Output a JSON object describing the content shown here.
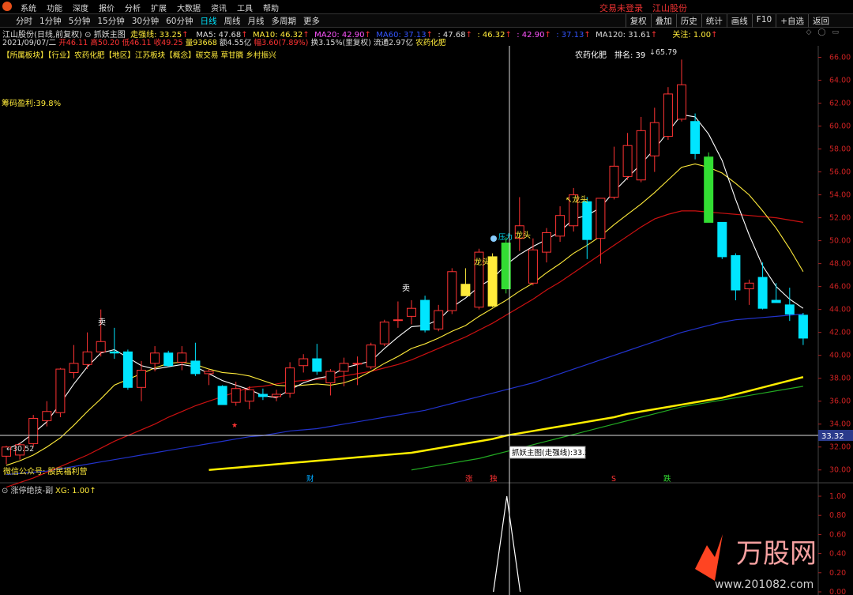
{
  "menubar": {
    "items": [
      "系统",
      "功能",
      "深度",
      "报价",
      "分析",
      "扩展",
      "大数据",
      "资讯",
      "工具",
      "帮助"
    ],
    "login_status": "交易未登录",
    "stock_title": "江山股份"
  },
  "periodbar": {
    "tabs": [
      "分时",
      "1分钟",
      "5分钟",
      "15分钟",
      "30分钟",
      "60分钟",
      "日线",
      "周线",
      "月线",
      "多周期",
      "更多"
    ],
    "active_tab": "日线",
    "tools": [
      "复权",
      "叠加",
      "历史",
      "统计",
      "画线",
      "F10",
      "+自选",
      "返回"
    ]
  },
  "info": {
    "stock_label": "江山股份(日线,前复权)",
    "indicator_name": "抓妖主图",
    "strong_line": "走强线: 33.25",
    "ma5": "MA5: 47.68",
    "ma10": "MA10: 46.32",
    "ma20": "MA20: 42.90",
    "ma60": "MA60: 37.13",
    "v1": ": 47.68",
    "v2": ": 46.32",
    "v3": ": 42.90",
    "v4": ": 37.13",
    "ma120": "MA120: 31.61",
    "focus": "关注: 1.00",
    "date": "2021/09/07/二",
    "open": "开46.11",
    "high": "高50.20",
    "low": "低46.11",
    "close": "收49.25",
    "volume": "量93668",
    "amount": "额4.55亿",
    "change": "幅3.60(7.89%)",
    "turnover": "换3.15%(里复权)",
    "float_shares": "流通2.97亿",
    "industry_tag": "农药化肥",
    "sector_line": "【所属板块】【行业】农药化肥【地区】江苏板块【概念】碳交易 草甘膦 乡村振兴"
  },
  "chart_labels": {
    "chip_profit": "筹码盈利:39.8%",
    "ranking_industry": "农药化肥",
    "ranking": "排名: 39",
    "peak_price": "65.79",
    "low_price": "30.52",
    "crosshair_label": "抓妖主图(走强线):33.25",
    "crosshair_price": "33.32",
    "wechat": "微信公众号: 股民福利营",
    "sell_1": "卖",
    "sell_2": "卖",
    "dragon_1": "龙头",
    "dragon_2": "龙头",
    "dragon_3": "龙头",
    "pressure": "压力",
    "event_cai": "财",
    "event_zhang": "涨",
    "event_du": "独",
    "event_s": "S",
    "event_die": "跌",
    "sub_indicator": "涨停绝技-副",
    "sub_value": "XG: 1.00",
    "watermark_name": "万股网",
    "watermark_url": "www.201082.com"
  },
  "y_axis_main": [
    "66.00",
    "64.00",
    "62.00",
    "60.00",
    "58.00",
    "56.00",
    "54.00",
    "52.00",
    "50.00",
    "48.00",
    "46.00",
    "44.00",
    "42.00",
    "40.00",
    "38.00",
    "36.00",
    "34.00",
    "32.00",
    "30.00"
  ],
  "y_axis_sub": [
    "1.00",
    "0.80",
    "0.60",
    "0.40",
    "0.20",
    "0.00"
  ],
  "chart_data": {
    "type": "candlestick",
    "y_range": [
      29.5,
      67
    ],
    "candles": [
      {
        "o": 31.2,
        "h": 32.1,
        "l": 30.5,
        "c": 32.0
      },
      {
        "o": 31.3,
        "h": 32.4,
        "l": 30.9,
        "c": 32.2
      },
      {
        "o": 32.3,
        "h": 34.8,
        "l": 32.0,
        "c": 34.5
      },
      {
        "o": 34.3,
        "h": 36.0,
        "l": 33.8,
        "c": 35.1
      },
      {
        "o": 35.0,
        "h": 38.9,
        "l": 34.6,
        "c": 38.8
      },
      {
        "o": 38.5,
        "h": 40.9,
        "l": 38.0,
        "c": 39.3
      },
      {
        "o": 39.2,
        "h": 42.0,
        "l": 38.8,
        "c": 40.3
      },
      {
        "o": 40.3,
        "h": 44.0,
        "l": 39.9,
        "c": 41.2
      },
      {
        "o": 40.3,
        "h": 42.4,
        "l": 39.7,
        "c": 40.2
      },
      {
        "o": 40.3,
        "h": 40.5,
        "l": 37.0,
        "c": 37.2
      },
      {
        "o": 37.2,
        "h": 39.5,
        "l": 36.0,
        "c": 38.7
      },
      {
        "o": 39.3,
        "h": 40.8,
        "l": 38.6,
        "c": 40.2
      },
      {
        "o": 40.2,
        "h": 40.4,
        "l": 39.0,
        "c": 39.1
      },
      {
        "o": 39.4,
        "h": 40.8,
        "l": 38.7,
        "c": 40.2
      },
      {
        "o": 39.5,
        "h": 41.1,
        "l": 38.2,
        "c": 38.4
      },
      {
        "o": 38.4,
        "h": 38.8,
        "l": 37.4,
        "c": 38.6
      },
      {
        "o": 37.3,
        "h": 37.4,
        "l": 35.8,
        "c": 35.7
      },
      {
        "o": 35.9,
        "h": 37.7,
        "l": 35.6,
        "c": 37.1
      },
      {
        "o": 36.0,
        "h": 37.3,
        "l": 35.3,
        "c": 37.0
      },
      {
        "o": 36.6,
        "h": 37.1,
        "l": 36.1,
        "c": 36.4
      },
      {
        "o": 36.4,
        "h": 37.0,
        "l": 36.0,
        "c": 36.6
      },
      {
        "o": 36.7,
        "h": 39.4,
        "l": 36.3,
        "c": 38.9
      },
      {
        "o": 39.1,
        "h": 40.1,
        "l": 38.5,
        "c": 39.7
      },
      {
        "o": 39.7,
        "h": 41.0,
        "l": 38.3,
        "c": 38.6
      },
      {
        "o": 37.6,
        "h": 38.8,
        "l": 36.5,
        "c": 38.6
      },
      {
        "o": 38.6,
        "h": 39.8,
        "l": 37.3,
        "c": 39.3
      },
      {
        "o": 39.3,
        "h": 39.9,
        "l": 37.4,
        "c": 39.3
      },
      {
        "o": 39.0,
        "h": 41.1,
        "l": 38.8,
        "c": 40.9
      },
      {
        "o": 41.0,
        "h": 43.1,
        "l": 40.8,
        "c": 42.9
      },
      {
        "o": 43.1,
        "h": 44.7,
        "l": 42.4,
        "c": 43.1
      },
      {
        "o": 43.4,
        "h": 44.8,
        "l": 42.7,
        "c": 44.1
      },
      {
        "o": 44.8,
        "h": 45.2,
        "l": 42.0,
        "c": 42.2
      },
      {
        "o": 42.3,
        "h": 44.4,
        "l": 42.1,
        "c": 43.9
      },
      {
        "o": 43.9,
        "h": 47.6,
        "l": 43.6,
        "c": 47.3
      },
      {
        "o": 46.2,
        "h": 47.6,
        "l": 45.3,
        "c": 45.2
      },
      {
        "o": 44.2,
        "h": 49.3,
        "l": 44.0,
        "c": 49.0
      },
      {
        "o": 44.3,
        "h": 48.9,
        "l": 44.2,
        "c": 48.6
      },
      {
        "o": 45.8,
        "h": 50.3,
        "l": 45.4,
        "c": 49.8
      },
      {
        "o": 50.2,
        "h": 53.8,
        "l": 49.1,
        "c": 51.3
      },
      {
        "o": 46.3,
        "h": 50.2,
        "l": 46.1,
        "c": 49.2
      },
      {
        "o": 49.0,
        "h": 51.1,
        "l": 48.1,
        "c": 50.7
      },
      {
        "o": 50.4,
        "h": 53.0,
        "l": 49.9,
        "c": 52.2
      },
      {
        "o": 51.3,
        "h": 54.6,
        "l": 50.8,
        "c": 54.0
      },
      {
        "o": 53.4,
        "h": 53.8,
        "l": 48.4,
        "c": 50.1
      },
      {
        "o": 50.2,
        "h": 53.4,
        "l": 48.0,
        "c": 53.7
      },
      {
        "o": 53.8,
        "h": 58.2,
        "l": 53.6,
        "c": 56.5
      },
      {
        "o": 55.6,
        "h": 59.4,
        "l": 55.3,
        "c": 58.3
      },
      {
        "o": 55.3,
        "h": 60.8,
        "l": 55.1,
        "c": 59.6
      },
      {
        "o": 57.4,
        "h": 61.6,
        "l": 56.0,
        "c": 60.3
      },
      {
        "o": 59.1,
        "h": 63.4,
        "l": 58.8,
        "c": 62.8
      },
      {
        "o": 60.6,
        "h": 65.8,
        "l": 60.4,
        "c": 63.6
      },
      {
        "o": 60.4,
        "h": 61.1,
        "l": 57.1,
        "c": 57.6
      },
      {
        "o": 57.3,
        "h": 57.7,
        "l": 51.6,
        "c": 51.6
      },
      {
        "o": 51.6,
        "h": 51.6,
        "l": 48.4,
        "c": 48.6
      },
      {
        "o": 48.7,
        "h": 48.9,
        "l": 44.8,
        "c": 45.7
      },
      {
        "o": 45.8,
        "h": 46.6,
        "l": 44.4,
        "c": 46.3
      },
      {
        "o": 46.8,
        "h": 48.1,
        "l": 44.0,
        "c": 44.1
      },
      {
        "o": 44.8,
        "h": 46.3,
        "l": 44.6,
        "c": 44.6
      },
      {
        "o": 44.4,
        "h": 45.9,
        "l": 43.0,
        "c": 43.6
      },
      {
        "o": 43.5,
        "h": 43.7,
        "l": 40.9,
        "c": 41.5
      }
    ],
    "special_colors": {
      "36": "#ffeb3b",
      "34": "#ffeb3b",
      "37": "#33dd33",
      "52": "#33dd33"
    },
    "ma5": [
      31.8,
      32.3,
      33.2,
      34.2,
      35.8,
      37.5,
      39.0,
      40.2,
      40.5,
      39.8,
      39.1,
      38.8,
      39.0,
      39.2,
      39.0,
      38.4,
      37.8,
      37.4,
      37.0,
      36.5,
      36.3,
      37.0,
      37.6,
      38.0,
      38.2,
      38.9,
      39.2,
      39.5,
      40.6,
      41.6,
      42.5,
      42.6,
      43.1,
      44.2,
      45.0,
      46.0,
      46.7,
      47.9,
      48.8,
      49.5,
      50.1,
      50.8,
      51.9,
      52.2,
      52.9,
      54.3,
      55.5,
      56.7,
      58.0,
      59.5,
      61.0,
      60.8,
      59.3,
      57.0,
      53.6,
      50.5,
      47.8,
      46.0,
      44.9,
      44.1
    ],
    "ma10": [
      30.4,
      30.8,
      31.3,
      32.0,
      32.8,
      33.9,
      35.1,
      36.2,
      37.4,
      37.9,
      38.4,
      38.9,
      39.3,
      39.4,
      39.2,
      38.8,
      38.5,
      38.4,
      38.2,
      37.8,
      37.4,
      37.3,
      37.4,
      37.5,
      37.4,
      37.6,
      38.0,
      38.6,
      39.3,
      39.9,
      40.6,
      41.0,
      41.5,
      42.1,
      42.6,
      43.4,
      44.1,
      44.8,
      45.6,
      46.3,
      47.2,
      48.0,
      48.9,
      49.6,
      50.4,
      51.4,
      52.3,
      53.2,
      54.2,
      55.3,
      56.4,
      56.7,
      56.4,
      55.9,
      55.0,
      54.0,
      52.6,
      51.1,
      49.3,
      47.3
    ],
    "ma20": [
      28.5,
      28.9,
      29.3,
      29.8,
      30.3,
      30.8,
      31.3,
      31.9,
      32.5,
      33.0,
      33.5,
      34.0,
      34.6,
      35.1,
      35.6,
      36.0,
      36.4,
      36.8,
      37.2,
      37.3,
      37.5,
      37.7,
      37.8,
      37.9,
      38.0,
      38.2,
      38.4,
      38.6,
      38.9,
      39.2,
      39.6,
      40.1,
      40.6,
      41.1,
      41.6,
      42.2,
      42.8,
      43.5,
      44.2,
      44.9,
      45.7,
      46.4,
      47.2,
      48.0,
      48.8,
      49.6,
      50.4,
      51.2,
      51.9,
      52.3,
      52.6,
      52.6,
      52.5,
      52.4,
      52.3,
      52.2,
      52.1,
      52.0,
      51.8,
      51.6
    ],
    "ma60": [
      29.6,
      29.7,
      29.8,
      29.9,
      30.1,
      30.3,
      30.5,
      30.7,
      30.9,
      31.1,
      31.3,
      31.5,
      31.7,
      31.9,
      32.1,
      32.3,
      32.5,
      32.7,
      32.9,
      33.0,
      33.2,
      33.4,
      33.5,
      33.6,
      33.8,
      34.0,
      34.2,
      34.4,
      34.6,
      34.8,
      35.0,
      35.2,
      35.5,
      35.8,
      36.1,
      36.4,
      36.7,
      37.0,
      37.3,
      37.6,
      38.0,
      38.4,
      38.8,
      39.2,
      39.6,
      40.0,
      40.4,
      40.8,
      41.2,
      41.6,
      42.0,
      42.3,
      42.6,
      42.9,
      43.1,
      43.2,
      43.3,
      43.4,
      43.5,
      43.6
    ],
    "strong_line": [
      null,
      null,
      null,
      null,
      null,
      null,
      null,
      null,
      null,
      null,
      null,
      null,
      null,
      null,
      null,
      30.0,
      30.1,
      30.2,
      30.3,
      30.4,
      30.5,
      30.6,
      30.7,
      30.8,
      30.9,
      31.0,
      31.1,
      31.2,
      31.3,
      31.4,
      31.5,
      31.7,
      31.9,
      32.1,
      32.3,
      32.5,
      32.7,
      33.0,
      33.2,
      33.4,
      33.6,
      33.8,
      34.0,
      34.2,
      34.4,
      34.6,
      34.9,
      35.1,
      35.3,
      35.5,
      35.7,
      35.9,
      36.1,
      36.3,
      36.6,
      36.9,
      37.2,
      37.5,
      37.8,
      38.1
    ],
    "green_line": [
      null,
      null,
      null,
      null,
      null,
      null,
      null,
      null,
      null,
      null,
      null,
      null,
      null,
      null,
      null,
      null,
      null,
      null,
      null,
      null,
      null,
      null,
      null,
      null,
      null,
      null,
      null,
      null,
      null,
      null,
      30.0,
      30.2,
      30.4,
      30.6,
      30.8,
      31.0,
      31.3,
      31.6,
      31.9,
      32.2,
      32.5,
      32.8,
      33.1,
      33.4,
      33.7,
      34.0,
      34.3,
      34.6,
      34.9,
      35.2,
      35.5,
      35.7,
      35.9,
      36.1,
      36.3,
      36.5,
      36.7,
      36.9,
      37.1,
      37.3
    ],
    "sub_xg": {
      "index": 37,
      "value": 1.0
    }
  },
  "colors": {
    "up": "#ff3333",
    "down": "#00e5ff",
    "ma5": "#ffffff",
    "ma10": "#ffeb3b",
    "ma20": "#cc1111",
    "ma60": "#2233cc",
    "strong": "#ffee00",
    "green": "#22aa22"
  }
}
